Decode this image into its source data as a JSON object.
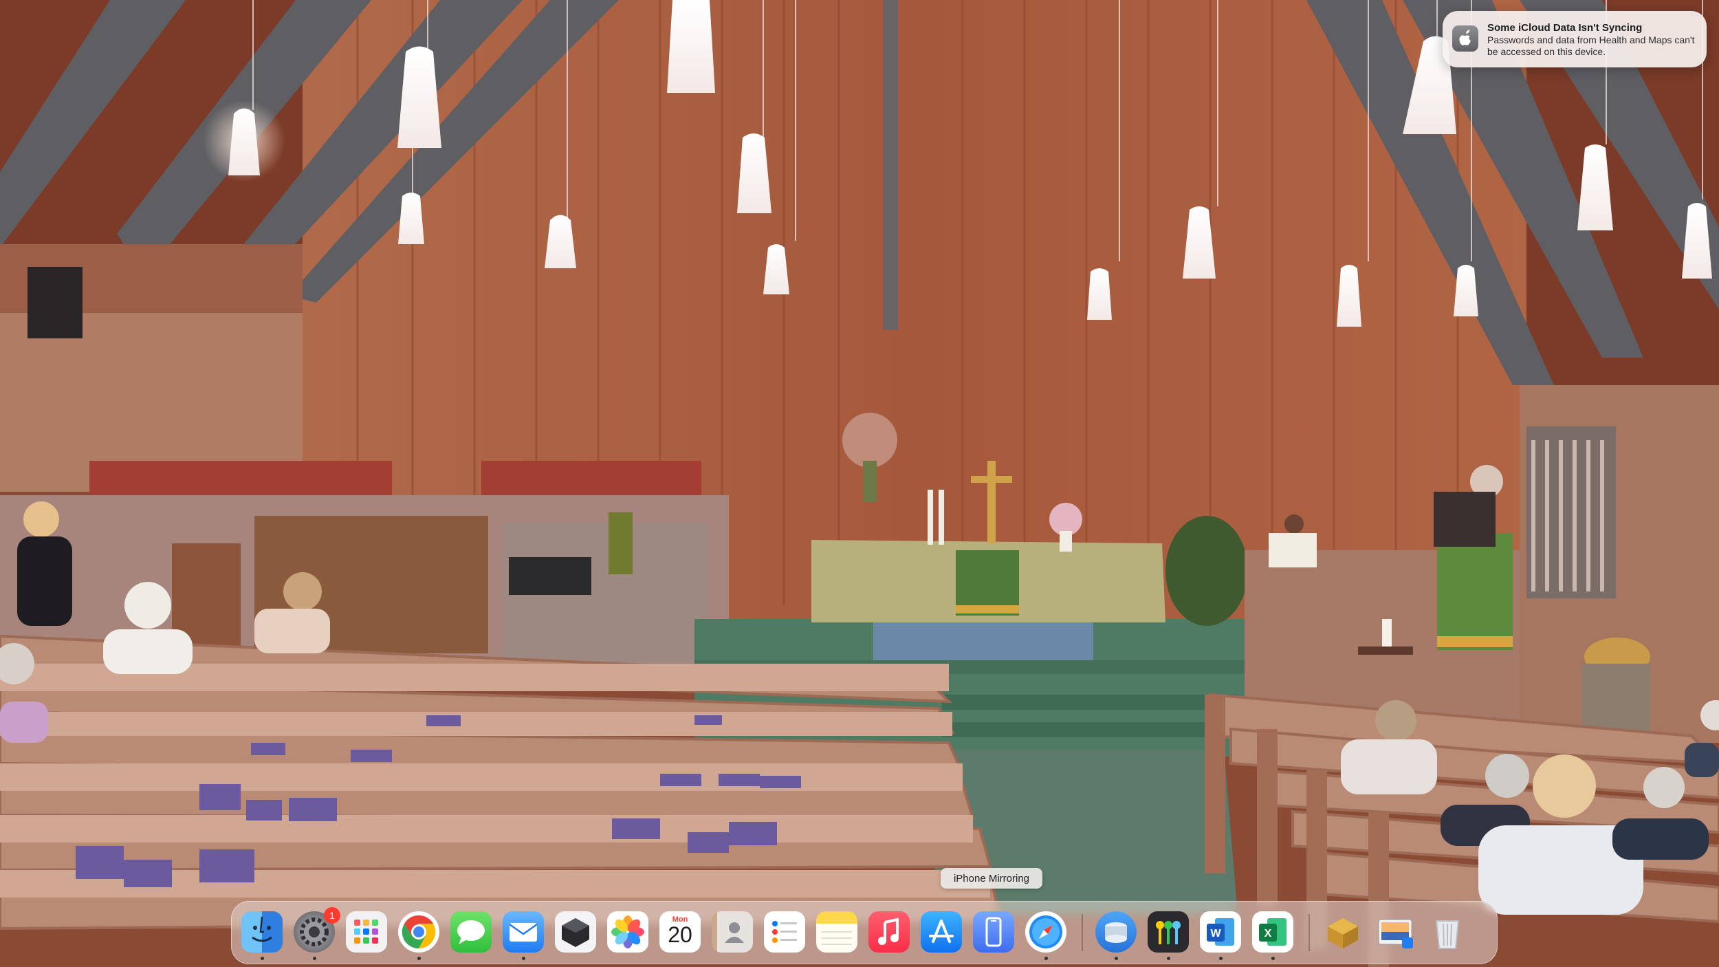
{
  "notification": {
    "title": "Some iCloud Data Isn't Syncing",
    "body": "Passwords and data from Health and Maps can't be accessed on this device.",
    "icon": "apple-logo-icon"
  },
  "tooltip": {
    "label": "iPhone Mirroring"
  },
  "dock": {
    "items": [
      {
        "id": "finder",
        "icon": "finder-icon",
        "running": true
      },
      {
        "id": "system-settings",
        "icon": "gear-icon",
        "badge": "1",
        "running": true
      },
      {
        "id": "launchpad",
        "icon": "launchpad-icon",
        "running": false
      },
      {
        "id": "chrome",
        "icon": "chrome-icon",
        "running": true
      },
      {
        "id": "messages",
        "icon": "messages-icon",
        "running": false
      },
      {
        "id": "mail",
        "icon": "mail-icon",
        "running": true
      },
      {
        "id": "app-box",
        "icon": "cube-icon",
        "running": false
      },
      {
        "id": "photos",
        "icon": "photos-icon",
        "running": false
      },
      {
        "id": "calendar",
        "icon": "calendar-icon",
        "month": "Mon",
        "day": "20",
        "running": false
      },
      {
        "id": "contacts",
        "icon": "contacts-icon",
        "running": false
      },
      {
        "id": "reminders",
        "icon": "reminders-icon",
        "running": false
      },
      {
        "id": "notes",
        "icon": "notes-icon",
        "running": false
      },
      {
        "id": "music",
        "icon": "music-icon",
        "running": false
      },
      {
        "id": "app-store",
        "icon": "app-store-icon",
        "running": false
      },
      {
        "id": "iphone-mirroring",
        "icon": "iphone-mirroring-icon",
        "running": false
      },
      {
        "id": "safari",
        "icon": "safari-icon",
        "running": true
      },
      {
        "id": "storage-app",
        "icon": "disk-icon",
        "running": true
      },
      {
        "id": "keychain",
        "icon": "keys-icon",
        "running": true
      },
      {
        "id": "word",
        "icon": "word-icon",
        "running": true
      },
      {
        "id": "excel",
        "icon": "excel-icon",
        "running": true
      },
      {
        "id": "archive",
        "icon": "package-icon",
        "running": false
      },
      {
        "id": "preview",
        "icon": "preview-icon",
        "running": false
      },
      {
        "id": "trash",
        "icon": "trash-icon",
        "running": false
      }
    ]
  },
  "colors": {
    "wood_wall": "#a8603f",
    "ceiling": "#7a3a28",
    "beam": "#5d5b5e",
    "pew": "#b98a74",
    "carpet": "#4f7a63",
    "altar_cloth": "#b7b07c",
    "parament": "#4f7a3a"
  }
}
